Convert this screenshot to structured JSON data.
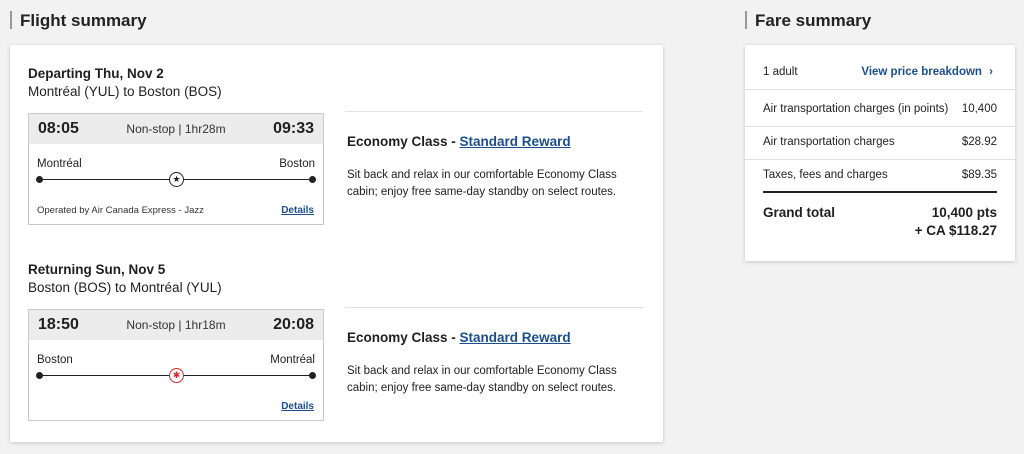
{
  "flight_summary": {
    "title": "Flight summary",
    "legs": [
      {
        "heading": "Departing Thu, Nov 2",
        "route": "Montréal (YUL) to Boston (BOS)",
        "dep_time": "08:05",
        "arr_time": "09:33",
        "stops_duration": "Non-stop | 1hr28m",
        "from_city": "Montréal",
        "to_city": "Boston",
        "operated_by": "Operated by Air Canada Express - Jazz",
        "details_label": "Details",
        "cabin": "Economy Class - ",
        "reward": "Standard Reward",
        "description": "Sit back and relax in our comfortable Economy Class cabin; enjoy free same-day standby on select routes."
      },
      {
        "heading": "Returning Sun, Nov 5",
        "route": "Boston (BOS) to Montréal (YUL)",
        "dep_time": "18:50",
        "arr_time": "20:08",
        "stops_duration": "Non-stop | 1hr18m",
        "from_city": "Boston",
        "to_city": "Montréal",
        "operated_by": "",
        "details_label": "Details",
        "cabin": "Economy Class - ",
        "reward": "Standard Reward",
        "description": "Sit back and relax in our comfortable Economy Class cabin; enjoy free same-day standby on select routes."
      }
    ]
  },
  "fare_summary": {
    "title": "Fare summary",
    "passengers": "1 adult",
    "breakdown_link": "View price breakdown",
    "rows": [
      {
        "label": "Air transportation charges (in points)",
        "value": "10,400"
      },
      {
        "label": "Air transportation charges",
        "value": "$28.92"
      },
      {
        "label": "Taxes, fees and charges",
        "value": "$89.35"
      }
    ],
    "grand_total_label": "Grand total",
    "grand_total_points": "10,400 pts",
    "grand_total_cash": "+ CA $118.27"
  },
  "icons": {
    "plane_departing": "air-canada-jazz-logo-icon",
    "plane_returning": "maple-leaf-icon",
    "chevron": "chevron-right-icon"
  },
  "colors": {
    "link": "#1b4f8b",
    "accent_red": "#d8292f"
  }
}
